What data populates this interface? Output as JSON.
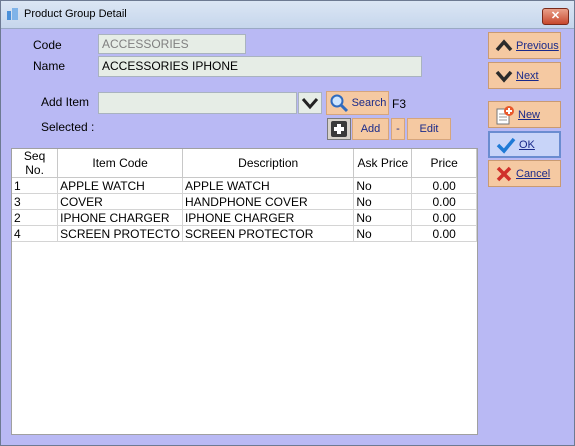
{
  "window": {
    "title": "Product Group Detail",
    "close_glyph": "✕"
  },
  "form": {
    "code_label": "Code",
    "code_value": "ACCESSORIES",
    "name_label": "Name",
    "name_value": "ACCESSORIES IPHONE",
    "add_item_label": "Add Item",
    "add_item_value": "",
    "selected_label": "Selected :"
  },
  "buttons": {
    "search": "Search",
    "search_shortcut": "F3",
    "add": "Add",
    "minus": "-",
    "edit": "Edit",
    "previous": "Previous",
    "next": "Next",
    "new": "New",
    "ok": "OK",
    "cancel": "Cancel"
  },
  "table": {
    "columns": [
      "Seq No.",
      "Item Code",
      "Description",
      "Ask Price",
      "Price"
    ],
    "rows": [
      [
        "1",
        "APPLE WATCH",
        "APPLE WATCH",
        "No",
        "0.00"
      ],
      [
        "3",
        "COVER",
        "HANDPHONE COVER",
        "No",
        "0.00"
      ],
      [
        "2",
        "IPHONE CHARGER",
        "IPHONE CHARGER",
        "No",
        "0.00"
      ],
      [
        "4",
        "SCREEN PROTECTO",
        "SCREEN PROTECTOR",
        "No",
        "0.00"
      ]
    ]
  },
  "colors": {
    "window_bg": "#b9b9f4",
    "button_bg": "#f5c9a2",
    "field_bg": "#e6ede6",
    "label_text": "#1a2a8a"
  },
  "icons": [
    "app-icon",
    "close-icon",
    "chevron-down-icon",
    "search-icon",
    "plus-icon",
    "chevron-up-icon",
    "new-document-icon",
    "check-icon",
    "x-icon"
  ]
}
